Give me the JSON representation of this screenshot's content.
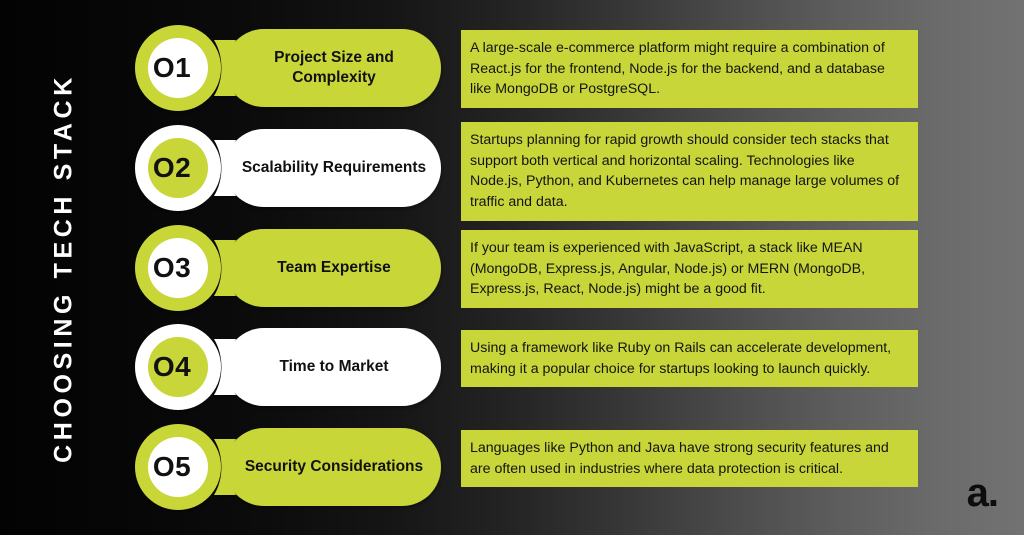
{
  "title": "CHOOSING TECH STACK",
  "logo": "a.",
  "colors": {
    "accent_green": "#c8d639",
    "white": "#ffffff",
    "text_dark": "#141414",
    "bg_left": "#030303",
    "bg_right": "#727272"
  },
  "rows": [
    {
      "number": "O1",
      "label": "Project Size and Complexity",
      "description": "A large-scale e-commerce platform might require a combination of React.js for the frontend, Node.js for the backend, and a database like MongoDB or PostgreSQL.",
      "style": "green-pill"
    },
    {
      "number": "O2",
      "label": "Scalability Requirements",
      "description": "Startups planning for rapid growth should consider tech stacks that support both vertical and horizontal scaling. Technologies like Node.js, Python, and Kubernetes can help manage large volumes of traffic and data.",
      "style": "white-pill"
    },
    {
      "number": "O3",
      "label": "Team Expertise",
      "description": "If your team is experienced with JavaScript, a stack like MEAN (MongoDB, Express.js, Angular, Node.js) or MERN (MongoDB, Express.js, React, Node.js) might be a good fit.",
      "style": "green-pill"
    },
    {
      "number": "O4",
      "label": "Time to Market",
      "description": "Using a framework like Ruby on Rails can accelerate development, making it a popular choice for startups looking to launch quickly.",
      "style": "white-pill"
    },
    {
      "number": "O5",
      "label": "Security Considerations",
      "description": "Languages like Python and Java have strong security features and are often used in industries where data protection is critical.",
      "style": "green-pill"
    }
  ]
}
